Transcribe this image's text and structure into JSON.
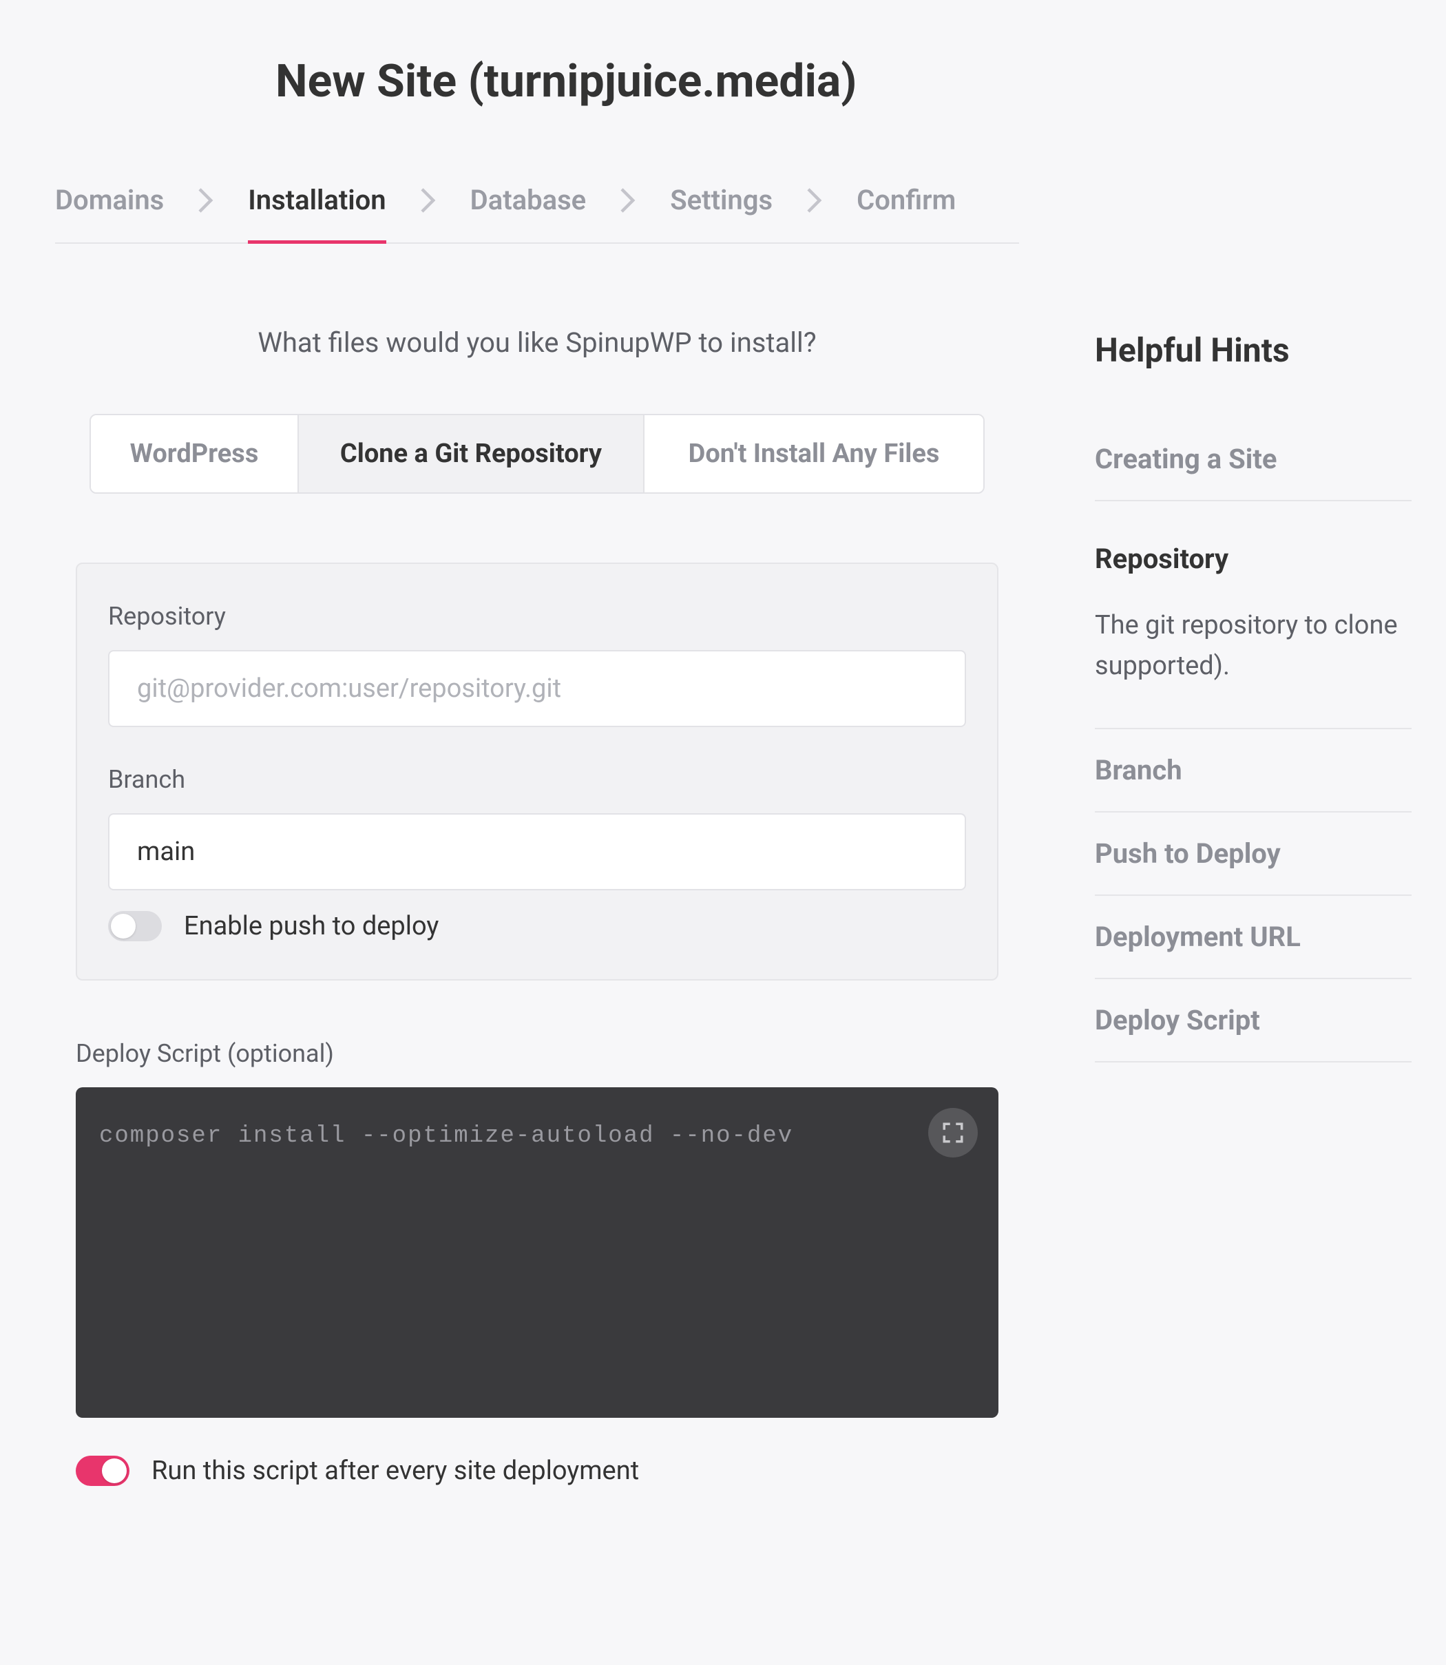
{
  "page_title": "New Site (turnipjuice.media)",
  "breadcrumb": {
    "items": [
      {
        "label": "Domains",
        "active": false
      },
      {
        "label": "Installation",
        "active": true
      },
      {
        "label": "Database",
        "active": false
      },
      {
        "label": "Settings",
        "active": false
      },
      {
        "label": "Confirm",
        "active": false
      }
    ]
  },
  "question": "What files would you like SpinupWP to install?",
  "tabs": {
    "wordpress": "WordPress",
    "git": "Clone a Git Repository",
    "none": "Don't Install Any Files"
  },
  "form": {
    "repo_label": "Repository",
    "repo_placeholder": "git@provider.com:user/repository.git",
    "repo_value": "",
    "branch_label": "Branch",
    "branch_value": "main",
    "push_deploy_label": "Enable push to deploy",
    "push_deploy_on": false
  },
  "deploy": {
    "label": "Deploy Script (optional)",
    "code": "composer install --optimize-autoload --no-dev",
    "run_label": "Run this script after every site deployment",
    "run_on": true
  },
  "hints": {
    "title": "Helpful Hints",
    "creating": "Creating a Site",
    "repo_head": "Repository",
    "repo_desc": "The git repository to clone supported).",
    "branch": "Branch",
    "push": "Push to Deploy",
    "url": "Deployment URL",
    "script": "Deploy Script"
  }
}
